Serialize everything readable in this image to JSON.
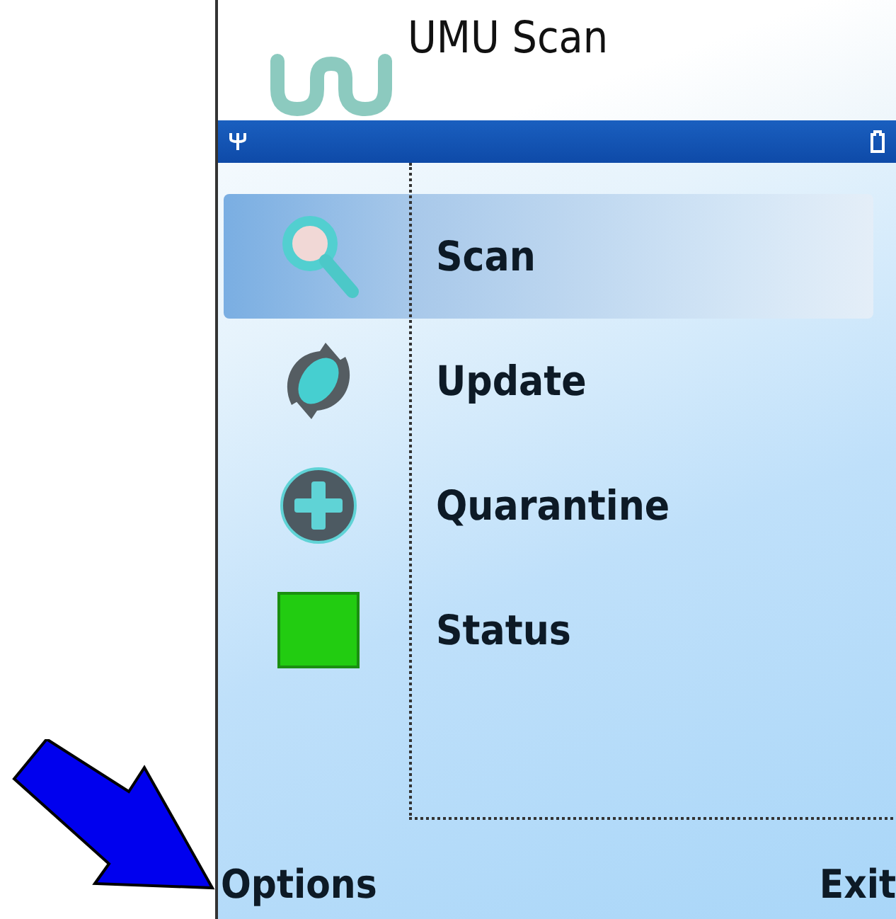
{
  "header": {
    "title": "UMU Scan"
  },
  "menu": [
    {
      "label": "Scan",
      "kind": "scan",
      "selected": true
    },
    {
      "label": "Update",
      "kind": "update",
      "selected": false
    },
    {
      "label": "Quarantine",
      "kind": "quarantine",
      "selected": false
    },
    {
      "label": "Status",
      "kind": "status",
      "selected": false
    }
  ],
  "softkeys": {
    "left": "Options",
    "right": "Exit"
  }
}
